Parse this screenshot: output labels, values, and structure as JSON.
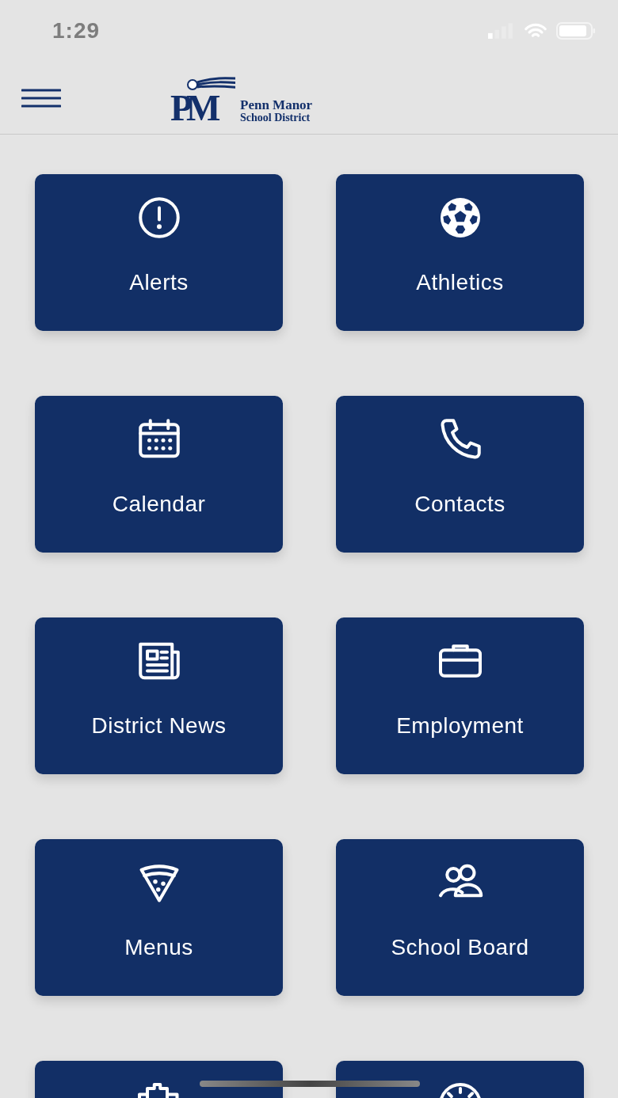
{
  "status_bar": {
    "time": "1:29"
  },
  "header": {
    "logo": {
      "monogram": "PM",
      "name": "Penn Manor",
      "subtitle": "School District"
    }
  },
  "tiles": [
    {
      "kind": "alert",
      "label": "Alerts"
    },
    {
      "kind": "ball",
      "label": "Athletics"
    },
    {
      "kind": "calendar",
      "label": "Calendar"
    },
    {
      "kind": "phone",
      "label": "Contacts"
    },
    {
      "kind": "news",
      "label": "District News"
    },
    {
      "kind": "briefcase",
      "label": "Employment"
    },
    {
      "kind": "pizza",
      "label": "Menus"
    },
    {
      "kind": "people",
      "label": "School Board"
    },
    {
      "kind": "building"
    },
    {
      "kind": "gauge"
    }
  ]
}
